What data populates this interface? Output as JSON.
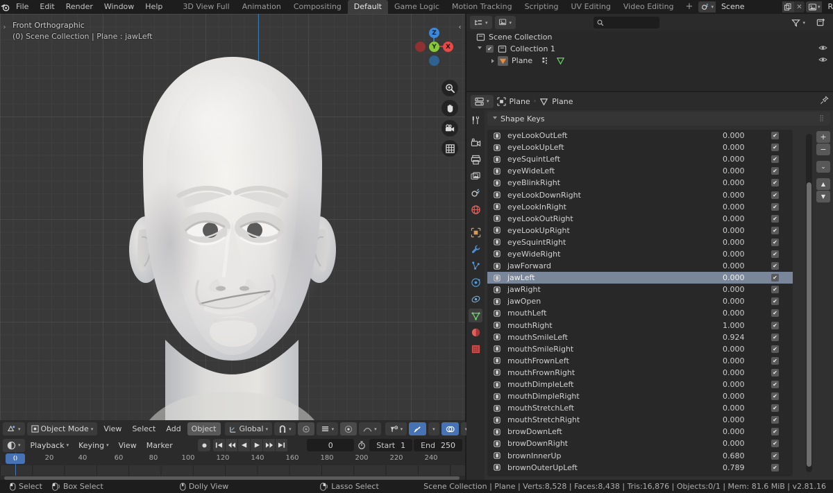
{
  "topbar": {
    "logo_icon": "blender-logo",
    "menus": [
      "File",
      "Edit",
      "Render",
      "Window",
      "Help"
    ],
    "workspaces": [
      {
        "label": "3D View Full",
        "active": false
      },
      {
        "label": "Animation",
        "active": false
      },
      {
        "label": "Compositing",
        "active": false
      },
      {
        "label": "Default",
        "active": true
      },
      {
        "label": "Game Logic",
        "active": false
      },
      {
        "label": "Motion Tracking",
        "active": false
      },
      {
        "label": "Scripting",
        "active": false
      },
      {
        "label": "UV Editing",
        "active": false
      },
      {
        "label": "Video Editing",
        "active": false
      }
    ],
    "add_workspace_label": "+",
    "scene_name": "Scene",
    "viewlayer_name": "RenderLayer"
  },
  "viewport": {
    "view_label": "Front Orthographic",
    "context_label": "(0) Scene Collection | Plane : jawLeft",
    "gizmo_axes": [
      {
        "label": "Z",
        "color": "#3f87d8"
      },
      {
        "label": "Y",
        "color": "#8ac53e"
      },
      {
        "label": "X",
        "color": "#e54b4b"
      }
    ],
    "nav_buttons": [
      "zoom-icon",
      "hand-icon",
      "camera-icon",
      "grid-icon"
    ]
  },
  "viewport_header": {
    "editor_type_icon": "editor-type-3dview-icon",
    "mode": "Object Mode",
    "menus": [
      "View",
      "Select",
      "Add",
      "Object"
    ],
    "transform_orientation": "Global",
    "snap_icon": "magnet-icon",
    "proportional_icon": "proportional-edit-icon",
    "falloff_icon": "falloff-smooth-icon",
    "visibility_icon": "visibility-icon",
    "gizmo_icon": "gizmo-icon",
    "overlays_icon": "overlays-icon",
    "xray_icon": "xray-icon",
    "shading": [
      "wireframe",
      "solid",
      "material",
      "rendered"
    ],
    "shading_active": "rendered"
  },
  "timeline": {
    "editor_type_icon": "editor-type-timeline-icon",
    "menus": [
      "Playback",
      "Keying",
      "View",
      "Marker"
    ],
    "record_icon": "record-icon",
    "transport": [
      "jump-start-icon",
      "prev-key-icon",
      "play-reverse-icon",
      "play-icon",
      "next-key-icon",
      "jump-end-icon"
    ],
    "current_frame": "0",
    "autokey_icon": "autokey-icon",
    "start_label": "Start",
    "start_value": "1",
    "end_label": "End",
    "end_value": "250",
    "ruler_ticks": [
      "0",
      "20",
      "40",
      "60",
      "80",
      "100",
      "120",
      "140",
      "160",
      "180",
      "200",
      "220",
      "240"
    ],
    "playhead_label": "0"
  },
  "outliner": {
    "display_mode_icon": "outliner-display-mode-icon",
    "filter_id_icon": "id-type-icon",
    "search_icon": "search-icon",
    "search_placeholder": "",
    "search_value": "",
    "filter_icon": "filter-icon",
    "new_collection_icon": "new-collection-icon",
    "rows": [
      {
        "indent": 0,
        "label": "Scene Collection",
        "icon": "collection-icon",
        "has_tri": false,
        "has_checkbox": false,
        "has_eye": false
      },
      {
        "indent": 1,
        "label": "Collection 1",
        "icon": "collection-icon",
        "has_tri": true,
        "has_checkbox": true,
        "has_eye": true
      },
      {
        "indent": 2,
        "label": "Plane",
        "icon": "mesh-object-icon",
        "has_tri": true,
        "has_checkbox": false,
        "has_eye": true,
        "extra_icons": [
          "modifier-icon",
          "mesh-data-icon"
        ]
      }
    ]
  },
  "properties": {
    "editor_type_icon": "editor-type-properties-icon",
    "breadcrumb": [
      {
        "label": "Plane",
        "icon": "object-icon"
      },
      {
        "label": "Plane",
        "icon": "mesh-data-icon"
      }
    ],
    "pin_icon": "pin-icon",
    "tabs": [
      {
        "name": "tool",
        "icon": "tool-icon",
        "active": false
      },
      {
        "name": "render",
        "icon": "render-icon",
        "active": false
      },
      {
        "name": "output",
        "icon": "output-icon",
        "active": false
      },
      {
        "name": "view-layer",
        "icon": "view-layer-icon",
        "active": false
      },
      {
        "name": "scene",
        "icon": "scene-icon",
        "active": false
      },
      {
        "name": "world",
        "icon": "world-icon",
        "active": false
      },
      {
        "name": "object",
        "icon": "object-icon",
        "active": false
      },
      {
        "name": "modifiers",
        "icon": "wrench-icon",
        "active": false
      },
      {
        "name": "particles",
        "icon": "particles-icon",
        "active": false
      },
      {
        "name": "physics",
        "icon": "physics-icon",
        "active": false
      },
      {
        "name": "constraints",
        "icon": "constraints-icon",
        "active": false
      },
      {
        "name": "object-data",
        "icon": "mesh-data-icon",
        "active": true
      },
      {
        "name": "material",
        "icon": "material-icon",
        "active": false
      },
      {
        "name": "texture",
        "icon": "texture-icon",
        "active": false
      }
    ],
    "panel_title": "Shape Keys",
    "panel_expanded": true,
    "side_buttons": [
      "add-shapekey-button",
      "remove-shapekey-button",
      "specials-menu-button",
      "move-up-button",
      "move-down-button"
    ],
    "side_button_labels": [
      "+",
      "−",
      "⌄",
      "▲",
      "▼"
    ],
    "shape_keys": [
      {
        "name": "eyeLookOutLeft",
        "value": "0.000",
        "enabled": true,
        "selected": false
      },
      {
        "name": "eyeLookUpLeft",
        "value": "0.000",
        "enabled": true,
        "selected": false
      },
      {
        "name": "eyeSquintLeft",
        "value": "0.000",
        "enabled": true,
        "selected": false
      },
      {
        "name": "eyeWideLeft",
        "value": "0.000",
        "enabled": true,
        "selected": false
      },
      {
        "name": "eyeBlinkRight",
        "value": "0.000",
        "enabled": true,
        "selected": false
      },
      {
        "name": "eyeLookDownRight",
        "value": "0.000",
        "enabled": true,
        "selected": false
      },
      {
        "name": "eyeLookInRight",
        "value": "0.000",
        "enabled": true,
        "selected": false
      },
      {
        "name": "eyeLookOutRight",
        "value": "0.000",
        "enabled": true,
        "selected": false
      },
      {
        "name": "eyeLookUpRight",
        "value": "0.000",
        "enabled": true,
        "selected": false
      },
      {
        "name": "eyeSquintRight",
        "value": "0.000",
        "enabled": true,
        "selected": false
      },
      {
        "name": "eyeWideRight",
        "value": "0.000",
        "enabled": true,
        "selected": false
      },
      {
        "name": "jawForward",
        "value": "0.000",
        "enabled": true,
        "selected": false
      },
      {
        "name": "jawLeft",
        "value": "0.000",
        "enabled": true,
        "selected": true
      },
      {
        "name": "jawRight",
        "value": "0.000",
        "enabled": true,
        "selected": false
      },
      {
        "name": "jawOpen",
        "value": "0.000",
        "enabled": true,
        "selected": false
      },
      {
        "name": "mouthLeft",
        "value": "0.000",
        "enabled": true,
        "selected": false
      },
      {
        "name": "mouthRight",
        "value": "1.000",
        "enabled": true,
        "selected": false
      },
      {
        "name": "mouthSmileLeft",
        "value": "0.924",
        "enabled": true,
        "selected": false
      },
      {
        "name": "mouthSmileRight",
        "value": "0.000",
        "enabled": true,
        "selected": false
      },
      {
        "name": "mouthFrownLeft",
        "value": "0.000",
        "enabled": true,
        "selected": false
      },
      {
        "name": "mouthFrownRight",
        "value": "0.000",
        "enabled": true,
        "selected": false
      },
      {
        "name": "mouthDimpleLeft",
        "value": "0.000",
        "enabled": true,
        "selected": false
      },
      {
        "name": "mouthDimpleRight",
        "value": "0.000",
        "enabled": true,
        "selected": false
      },
      {
        "name": "mouthStretchLeft",
        "value": "0.000",
        "enabled": true,
        "selected": false
      },
      {
        "name": "mouthStretchRight",
        "value": "0.000",
        "enabled": true,
        "selected": false
      },
      {
        "name": "browDownLeft",
        "value": "0.000",
        "enabled": true,
        "selected": false
      },
      {
        "name": "browDownRight",
        "value": "0.000",
        "enabled": true,
        "selected": false
      },
      {
        "name": "brownInnerUp",
        "value": "0.680",
        "enabled": true,
        "selected": false
      },
      {
        "name": "brownOuterUpLeft",
        "value": "0.789",
        "enabled": true,
        "selected": false
      }
    ]
  },
  "statusbar": {
    "hints": [
      {
        "icon": "mouse-left-icon",
        "label": "Select"
      },
      {
        "icon": "mouse-left-drag-icon",
        "label": "Box Select"
      },
      {
        "icon": "mouse-middle-icon",
        "label": "Dolly View"
      },
      {
        "icon": "mouse-right-drag-icon",
        "label": "Lasso Select"
      }
    ],
    "stats": "Scene Collection | Plane | Verts:8,528 | Faces:8,438 | Tris:16,876 | Objects:0/1 | Mem: 81.6 MiB | v2.81.16"
  },
  "colors": {
    "accent_blue": "#4772b3",
    "selection_row": "#7a8699",
    "axis_x": "#e54b4b",
    "axis_y": "#8ac53e",
    "axis_z": "#3f87d8",
    "viewport_bg": "#393939",
    "panel_bg": "#303030",
    "editor_bg": "#282828"
  }
}
